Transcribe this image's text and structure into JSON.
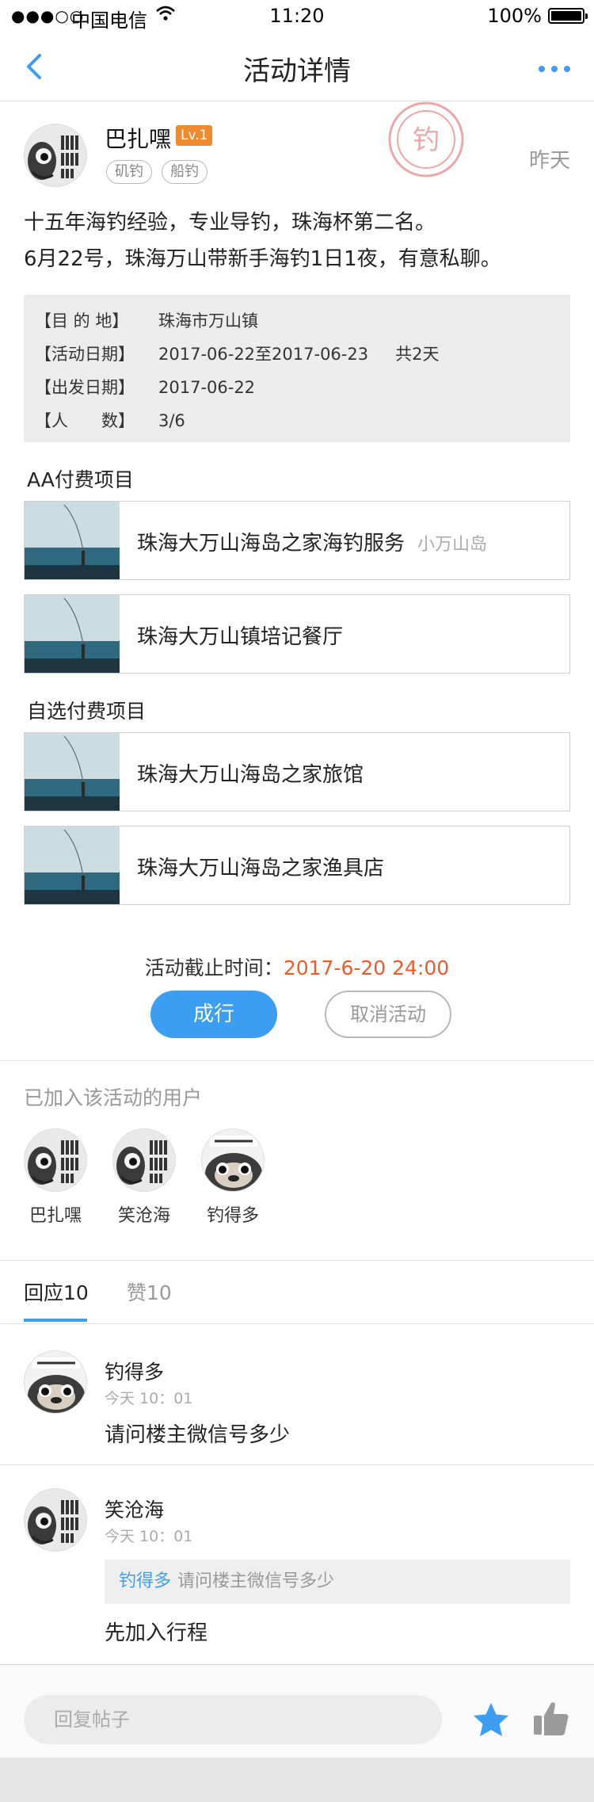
{
  "status_bar": {
    "signal": "●●●○○",
    "carrier": "中国电信",
    "time": "11:20",
    "battery": "100%"
  },
  "nav": {
    "title": "活动详情",
    "back_icon": "chevron-left-icon",
    "more_icon": "more-dots-icon",
    "accent_color": "#3b9ef0"
  },
  "post": {
    "author": "巴扎嘿",
    "level": "Lv.1",
    "tags": [
      "矶钓",
      "船钓"
    ],
    "time": "昨天",
    "stamp_text": "钓",
    "body_lines": [
      "十五年海钓经验，专业导钓，珠海杯第二名。",
      "6月22号，珠海万山带新手海钓1日1夜，有意私聊。"
    ]
  },
  "info": {
    "destination_label": "【目 的 地】",
    "destination": "珠海市万山镇",
    "activity_date_label": "【活动日期】",
    "activity_date": "2017-06-22至2017-06-23",
    "duration": "共2天",
    "departure_label": "【出发日期】",
    "departure": "2017-06-22",
    "people_label": "【人　　数】",
    "people": "3/6"
  },
  "aa_section": {
    "title": "AA付费项目",
    "items": [
      {
        "name": "珠海大万山海岛之家海钓服务",
        "sub": "小万山岛"
      },
      {
        "name": "珠海大万山镇培记餐厅",
        "sub": ""
      }
    ]
  },
  "optional_section": {
    "title": "自选付费项目",
    "items": [
      {
        "name": "珠海大万山海岛之家旅馆"
      },
      {
        "name": "珠海大万山海岛之家渔具店"
      }
    ]
  },
  "deadline": {
    "label": "活动截止时间：",
    "value": "2017-6-20 24:00",
    "value_color": "#f05a28"
  },
  "actions": {
    "go": "成行",
    "cancel": "取消活动"
  },
  "joined": {
    "title": "已加入该活动的用户",
    "members": [
      "巴扎嘿",
      "笑沧海",
      "钓得多"
    ]
  },
  "tabs": {
    "replies": "回应10",
    "likes": "赞10"
  },
  "replies": [
    {
      "name": "钓得多",
      "time": "今天 10：01",
      "text": "请问楼主微信号多少"
    },
    {
      "name": "笑沧海",
      "time": "今天 10：01",
      "quote_name": "钓得多",
      "quote_text": "请问楼主微信号多少",
      "text": "先加入行程"
    }
  ],
  "bottom": {
    "placeholder": "回复帖子",
    "star_icon": "star-icon",
    "like_icon": "thumbs-up-icon"
  }
}
